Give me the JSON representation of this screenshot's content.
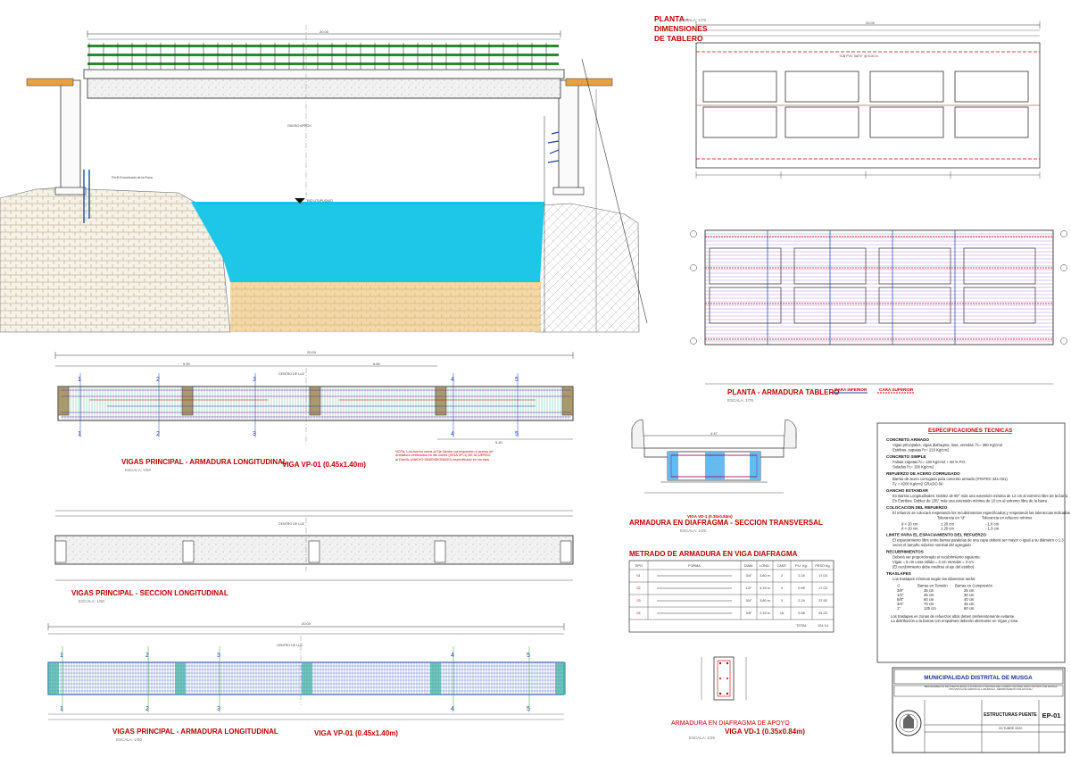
{
  "elevation": {
    "labels": {
      "span": "20.00",
      "gauge": "GALIBO APROX.",
      "river": "RIO UTUPUQUIO",
      "rock": "Perfil Encontrado de la Roca"
    }
  },
  "plan": {
    "title_lines": [
      "PLANTA -",
      "DIMENSIONES",
      "DE TABLERO"
    ],
    "scale": "ESCALA: 1/75",
    "length": "20.00",
    "pipe_label": "TUB PVC SAP2\" @ 5.00 m"
  },
  "plan_rebar": {
    "title": "PLANTA - ARMADURA TABLERO",
    "scale": "ESCALA: 1/75",
    "legend_inferior": "CARA INFERIOR",
    "legend_superior": "CARA SUPERIOR"
  },
  "beam_long": {
    "title": "VIGAS PRINCIPAL - ARMADURA LONGITUDINAL",
    "scale": "ESCALA: 1/50",
    "beam": "VIGA VP-01 (0.45x1.40m)",
    "span": "20.00",
    "d1": "9.90",
    "d2": "5.60",
    "d3": "5.40",
    "center": "CENTRO DE LUZ",
    "axes": [
      "1",
      "2",
      "3",
      "4",
      "5"
    ],
    "note": "NOTA: Los aceros cerca al Eje Neutro corresponden a aceros de Armadura verificados en las cortes (VIGA VP-1) DE ACUERDO al Diseño (ANEXO DIMENSIONADO) especificado en los ejes"
  },
  "beam_sect": {
    "title": "VIGAS PRINCIPAL - SECCION LONGITUDINAL",
    "scale": "ESCALA: 1/50",
    "center": "CENTRO DE LUZ"
  },
  "beam_long2": {
    "title": "VIGAS PRINCIPAL - ARMADURA LONGITUDINAL",
    "scale": "ESCALA: 1/50",
    "beam": "VIGA VP-01 (0.45x1.40m)",
    "span": "20.00",
    "center": "CENTRO DE LUZ",
    "axes": [
      "1",
      "2",
      "3",
      "4",
      "5"
    ]
  },
  "diaphragm": {
    "title": "ARMADURA EN DIAFRAGMA - SECCION TRANSVERSAL",
    "scale": "ESCALA: 1/25",
    "beam": "VIGA VD-1 (0.35x0.84m)",
    "width": "4.47"
  },
  "schedule": {
    "title": "METRADO DE ARMADURA EN VIGA DIAFRAGMA",
    "headers": [
      "TIPO",
      "FORMA",
      "DIAM.",
      "LONG.",
      "CANT.",
      "P.U. Kg.",
      "PESO Kg."
    ],
    "rows": [
      [
        "01",
        "",
        "3/4\"",
        "3.80 m",
        "2",
        "2.24",
        "17.03"
      ],
      [
        "02",
        "",
        "1/2\"",
        "4.15 m",
        "4",
        "0.99",
        "17.03"
      ],
      [
        "03",
        "",
        "3/4\"",
        "3.80 m",
        "3",
        "2.24",
        "37.92"
      ],
      [
        "04",
        "",
        "3/8\"",
        "2.15 m",
        "16",
        "0.56",
        "41.23"
      ]
    ],
    "total_label": "TOTAL",
    "total": "124.14"
  },
  "support": {
    "title": "ARMADURA EN DIAFRAGMA DE APOYO",
    "scale": "ESCALA: 1/25",
    "beam": "VIGA VD-1 (0.35x0.84m)"
  },
  "specs": {
    "title": "ESPECIFICACIONES TECNICAS",
    "sections": [
      {
        "h": "CONCRETO ARMADO",
        "lines": [
          "Vigas principales, vigas diafragma, losa, veredas: f'c= 280 Kg/cm2",
          "Estribos, zapatas                                         f'c= 210 Kg/cm2"
        ]
      },
      {
        "h": "CONCRETO SIMPLE",
        "lines": [
          "Falsas zapatas                          f'c= 140 Kg/cm2 + 50 % P.G.",
          "Solados                                    f'c= 100 Kg/cm2"
        ]
      },
      {
        "h": "REFUERZO DE ACERO CORRUGADO",
        "lines": [
          "Barras de acero corrugado para concreto armado (ITINTEC 341-031)",
          "Fy = 4200 Kg/cm2   GRADO 60"
        ]
      },
      {
        "h": "GANCHO ESTANDAR",
        "lines": [
          "En Barras Longitudinales: Doblez de 90° más una extensión mínima de 12 cm al extremo libre de la barra",
          "En Estribos: Doblez de 135° más una extensión mínima de 10 cm al extremo libre de la barra"
        ]
      },
      {
        "h": "COLOCACION DEL REFUERZO",
        "lines": [
          "El refuerzo se colocará respetando los recubrimientos especificados y respetando las tolerancias indicadas"
        ]
      },
      {
        "h": "LIMITE PARA EL ESPACIAMIENTO DEL REFUERZO",
        "lines": [
          "El espaciamiento libre entre barras paralelas de una capa deberá ser mayor o igual a su diámetro o 1.3",
          "veces el tamaño máximo nominal del agregado"
        ]
      },
      {
        "h": "RECUBRIMIENTOS",
        "lines": [
          "Deberá ser proporcionado el recubrimiento siguiente:",
          "Vigas = 5 cm          Losa sólida = 3 cm         Veredas = 3 cm",
          "(El recubrimiento debe medirse al eje del estribo)"
        ]
      },
      {
        "h": "TRASLAPES",
        "lines": [
          "Los traslapes mínimos según los diámetros serán:"
        ]
      }
    ],
    "tol_headers": [
      "Tolerancia en \"d\"",
      "Tolerancia en refuerzo mínimo"
    ],
    "tol_rows": [
      [
        "d < 20 cm",
        "± 20 cm",
        "- 1.0 cm"
      ],
      [
        "d < 20 cm",
        "± 20 cm",
        "- 1.3 cm"
      ]
    ],
    "lap_headers": [
      "∅",
      "Barras en Tensión",
      "Barras en Compresión"
    ],
    "lap_rows": [
      [
        "3/8\"",
        "35 cm",
        "25 cm"
      ],
      [
        "1/2\"",
        "45 cm",
        "30 cm"
      ],
      [
        "5/8\"",
        "60 cm",
        "40 cm"
      ],
      [
        "3/4\"",
        "70 cm",
        "45 cm"
      ],
      [
        "1\"",
        "125 cm",
        "60 cm"
      ]
    ],
    "footer": [
      "Los traslapes en zonas de refuerzos altos deben preferentemente evitarse.",
      "La distribución a la barras con empalmes deberán alternarse en Vigas y losa"
    ]
  },
  "titleblock": {
    "municipality": "MUNICIPALIDAD DISTRITAL DE MUSGA",
    "project": "MEJORAMIENTO DE PUENTE EN EL ILA CIRCUITO VECINAL DEL CAMINO VECINAL ANCO DISTRITO DE MUSGA PROVINCIA DE MARISCAL LUZURIAGA, DEPARTAMENTO DE ANCASH",
    "sheet_title": "ESTRUCTURAS PUENTE",
    "sheet_code": "EP-01",
    "date": "OCTUBRE 2020"
  },
  "colors": {
    "title_red": "#c00000",
    "water": "#1ec7e8",
    "rebar": "#7a1fb0",
    "dim": "#333333",
    "grid_green": "#2aa02a"
  }
}
